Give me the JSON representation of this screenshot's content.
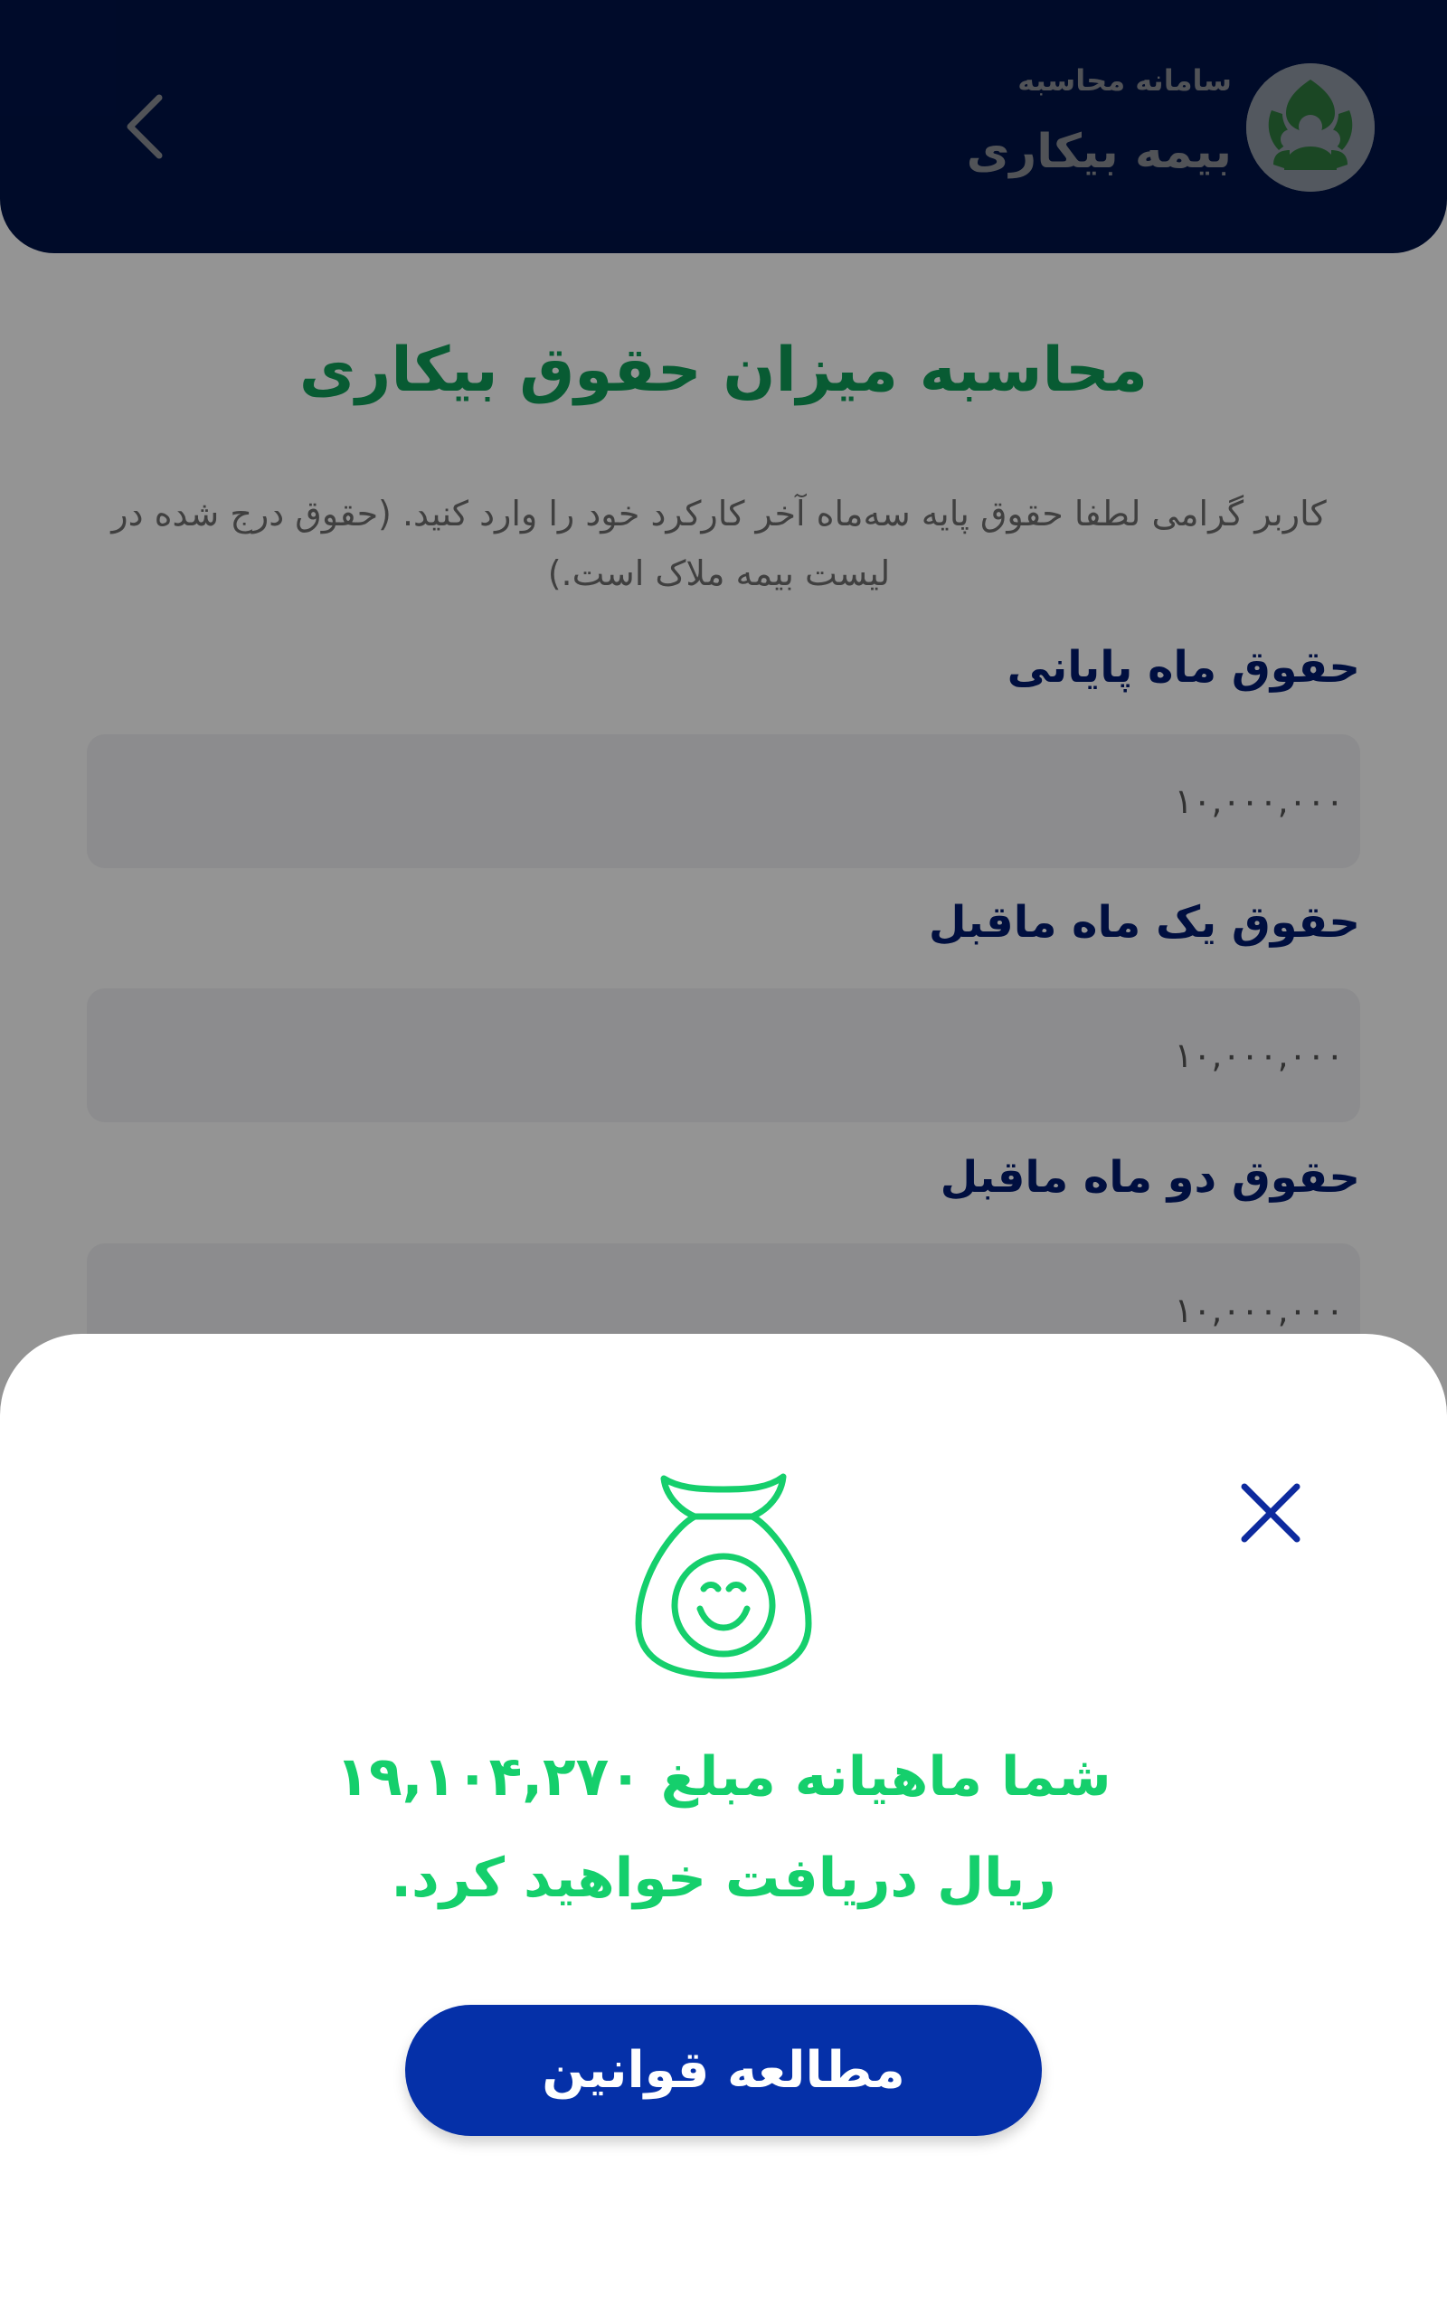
{
  "header": {
    "subtitle": "سامانه محاسبه",
    "title": "بیمه بیکاری"
  },
  "page": {
    "title": "محاسبه میزان حقوق بیکاری",
    "intro": "کاربر گرامی لطفا حقوق پایه سه‌ماه آخر کارکرد خود را وارد کنید. (حقوق درج شده در لیست بیمه ملاک است.)"
  },
  "fields": [
    {
      "label": "حقوق ماه پایانی",
      "value": "۱۰,۰۰۰,۰۰۰"
    },
    {
      "label": "حقوق یک ماه ماقبل",
      "value": "۱۰,۰۰۰,۰۰۰"
    },
    {
      "label": "حقوق دو ماه ماقبل",
      "value": "۱۰,۰۰۰,۰۰۰"
    }
  ],
  "sheet": {
    "result_line1": "شما ماهیانه مبلغ ۱۹,۱۰۴,۲۷۰",
    "result_line2": "ریال دریافت خواهید کرد.",
    "button_label": "مطالعه قوانین"
  },
  "colors": {
    "header_bg": "#001348",
    "title_green": "#0f9d58",
    "result_green": "#15cf6c",
    "button_blue": "#0530a8",
    "close_icon": "#0d2a9e"
  },
  "icons": {
    "back": "chevron-left-icon",
    "logo": "unemployment-insurance-logo-icon",
    "close": "close-icon",
    "money_bag": "money-bag-smile-icon"
  }
}
